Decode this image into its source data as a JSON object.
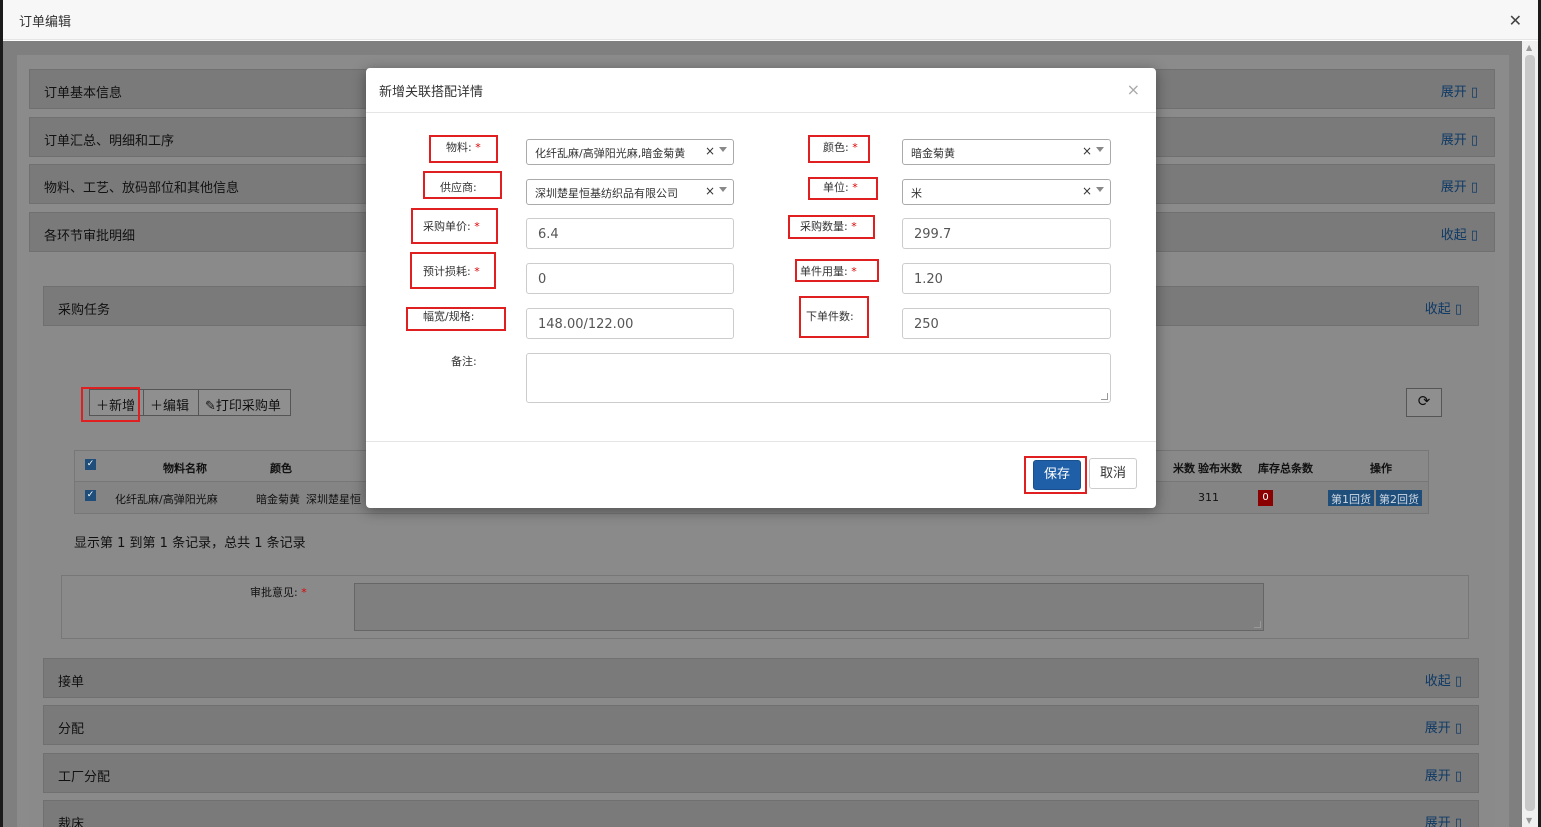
{
  "window": {
    "title": "订单编辑",
    "close_glyph": "✕"
  },
  "panels": {
    "basic": {
      "title": "订单基本信息",
      "toggle": "展开 ▯"
    },
    "summary": {
      "title": "订单汇总、明细和工序",
      "toggle": "展开 ▯"
    },
    "materials": {
      "title": "物料、工艺、放码部位和其他信息",
      "toggle": "展开 ▯"
    },
    "approval": {
      "title": "各环节审批明细",
      "toggle": "收起 ▯"
    },
    "purchase": {
      "title": "采购任务",
      "toggle": "收起 ▯"
    },
    "receive": {
      "title": "接单",
      "toggle": "收起 ▯"
    },
    "assign": {
      "title": "分配",
      "toggle": "展开 ▯"
    },
    "factory": {
      "title": "工厂分配",
      "toggle": "展开 ▯"
    },
    "cut": {
      "title": "裁床",
      "toggle": "展开 ▯"
    }
  },
  "toolbar": {
    "add": "新增",
    "edit": "编辑",
    "print": "打印采购单"
  },
  "table": {
    "headers_left": [
      "物料名称",
      "颜色"
    ],
    "headers_right": [
      "米数",
      "验布米数",
      "库存总条数",
      "操作"
    ],
    "row": {
      "material": "化纤乱麻/高弹阳光麻",
      "color": "暗金菊黄",
      "supplier_partial": "深圳楚星恒",
      "inspect_meters": "311",
      "stock_count": "0",
      "action1": "第1回货",
      "action2": "第2回货"
    }
  },
  "records_text": "显示第 1 到第 1 条记录，总共 1 条记录",
  "approve": {
    "label": "审批意见:",
    "req": "*"
  },
  "modal": {
    "title": "新增关联搭配详情",
    "close": "×",
    "fields": {
      "material": {
        "label": "物料:",
        "value": "化纤乱麻/高弹阳光麻,暗金菊黄"
      },
      "color": {
        "label": "颜色:",
        "value": "暗金菊黄"
      },
      "supplier": {
        "label": "供应商:",
        "value": "深圳楚星恒基纺织品有限公司"
      },
      "unit": {
        "label": "单位:",
        "value": "米"
      },
      "unit_price": {
        "label": "采购单价:",
        "value": "6.4"
      },
      "quantity": {
        "label": "采购数量:",
        "value": "299.7"
      },
      "loss": {
        "label": "预计损耗:",
        "value": "0"
      },
      "usage": {
        "label": "单件用量:",
        "value": "1.20"
      },
      "width": {
        "label": "幅宽/规格:",
        "value": "148.00/122.00"
      },
      "pieces": {
        "label": "下单件数:",
        "value": "250"
      },
      "remark": {
        "label": "备注:",
        "value": ""
      }
    },
    "req": "*",
    "clear": "×",
    "save": "保存",
    "cancel": "取消"
  },
  "icons": {
    "refresh": "refresh-icon",
    "plus": "plus-icon",
    "pencil": "pencil-icon"
  }
}
